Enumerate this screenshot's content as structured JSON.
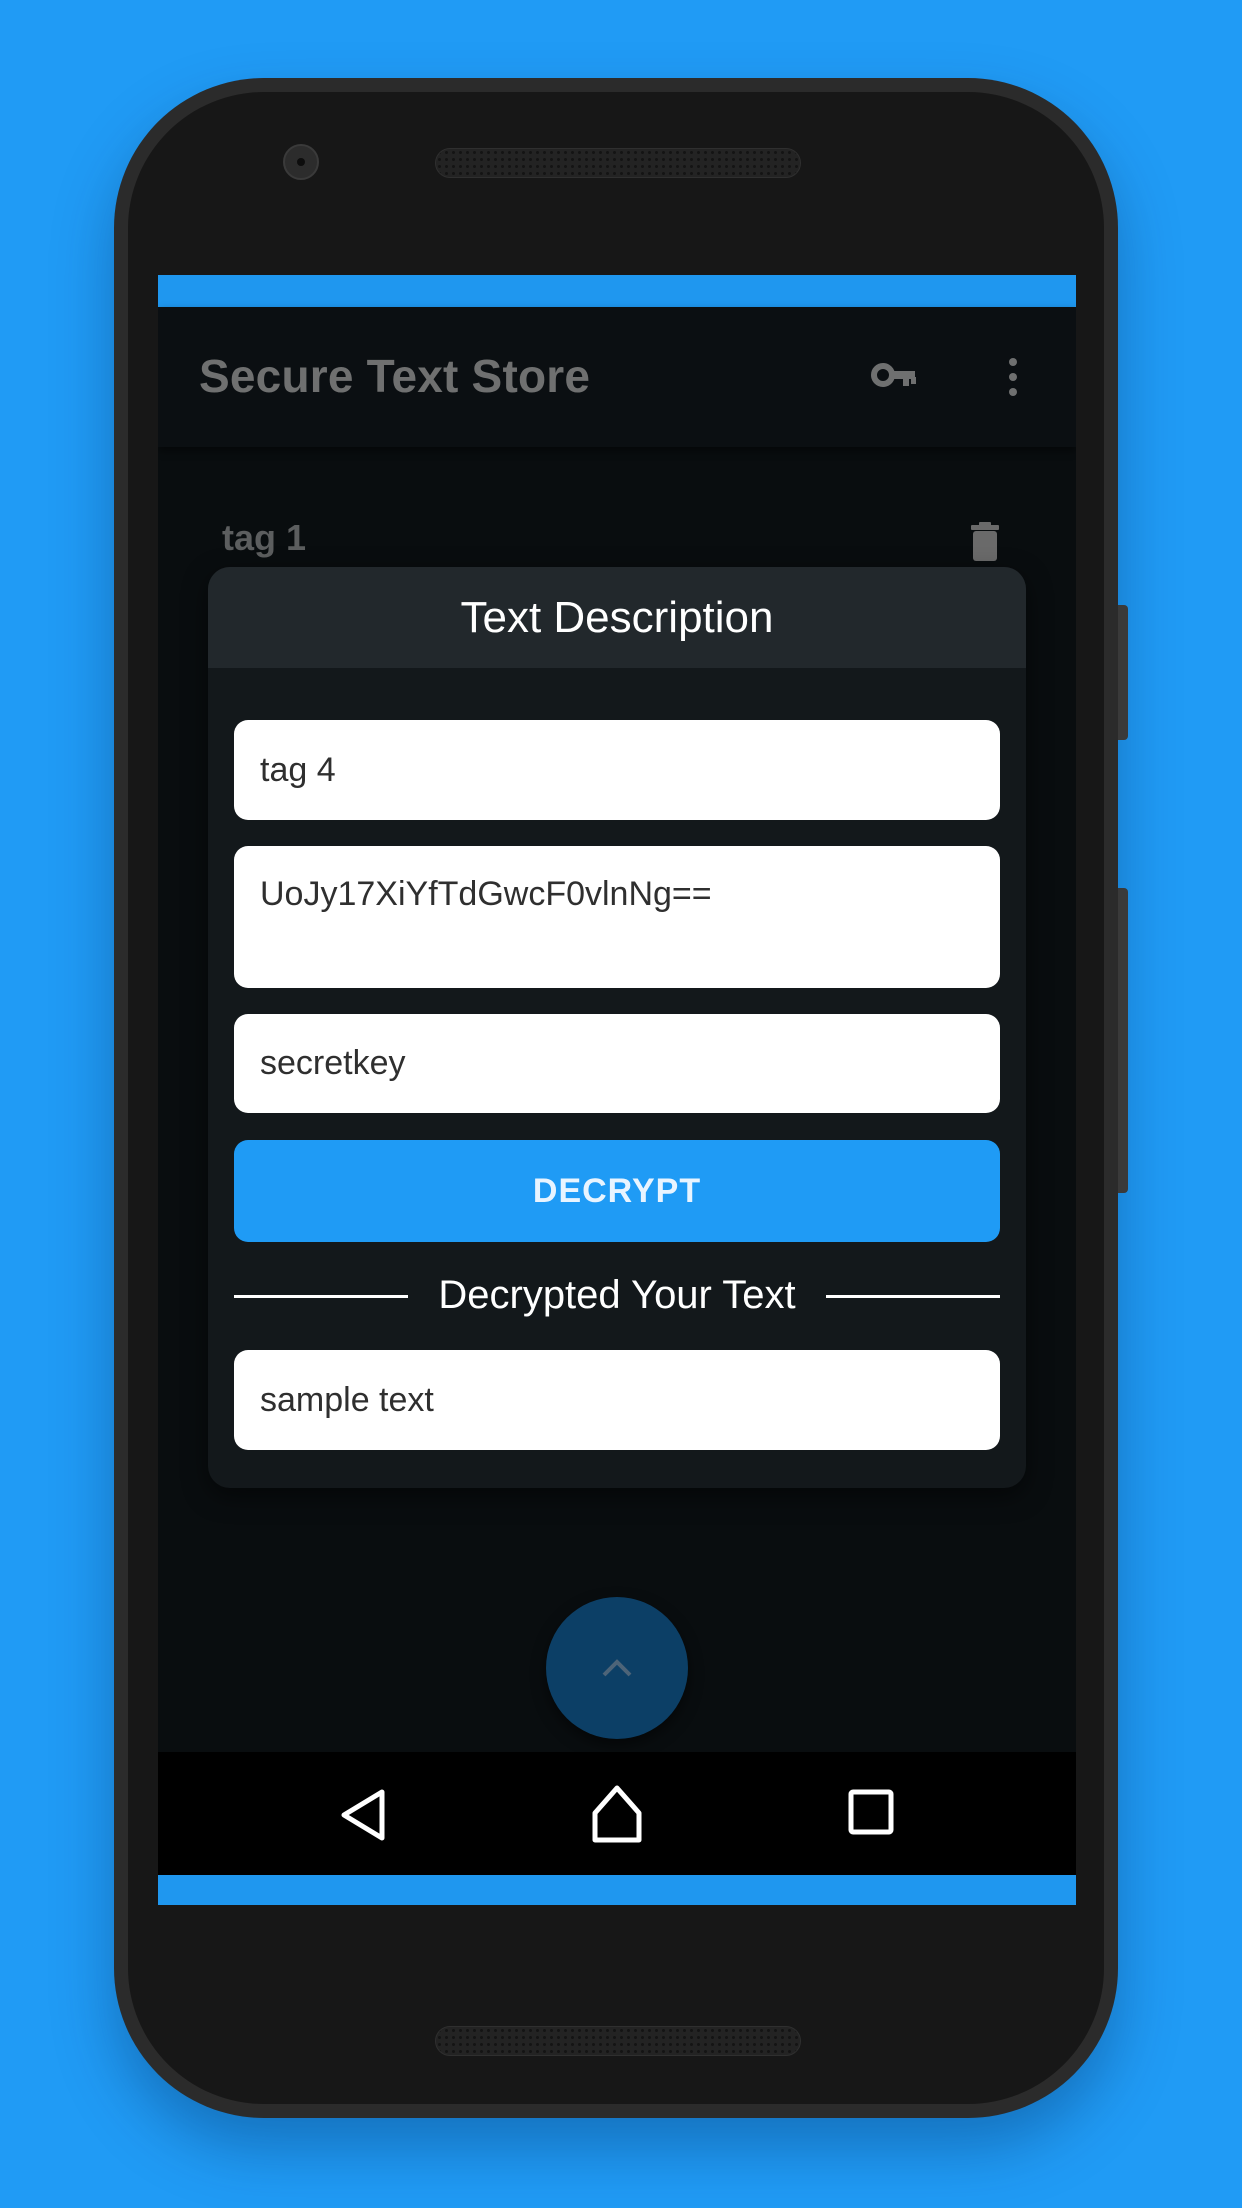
{
  "app": {
    "title": "Secure Text Store",
    "accent_color": "#1f9bf5",
    "background_color": "#209bf5"
  },
  "app_bar": {
    "actions": [
      {
        "icon": "key-icon",
        "label": "Key"
      },
      {
        "icon": "more-vert-icon",
        "label": "More options"
      }
    ]
  },
  "list": {
    "items": [
      {
        "tag": "tag 1",
        "action_icon": "trash-icon"
      }
    ]
  },
  "dialog": {
    "title": "Text Description",
    "tag_field": {
      "value": "tag 4"
    },
    "cipher_field": {
      "value": "UoJy17XiYfTdGwcF0vlnNg=="
    },
    "key_field": {
      "value": "secretkey"
    },
    "decrypt_button": {
      "label": "DECRYPT"
    },
    "result_section_label": "Decrypted Your Text",
    "result_field": {
      "value": "sample text"
    }
  },
  "fab": {
    "icon": "chevron-up-icon"
  },
  "nav_bar": {
    "buttons": [
      {
        "icon": "back-icon"
      },
      {
        "icon": "home-icon"
      },
      {
        "icon": "recents-icon"
      }
    ]
  }
}
